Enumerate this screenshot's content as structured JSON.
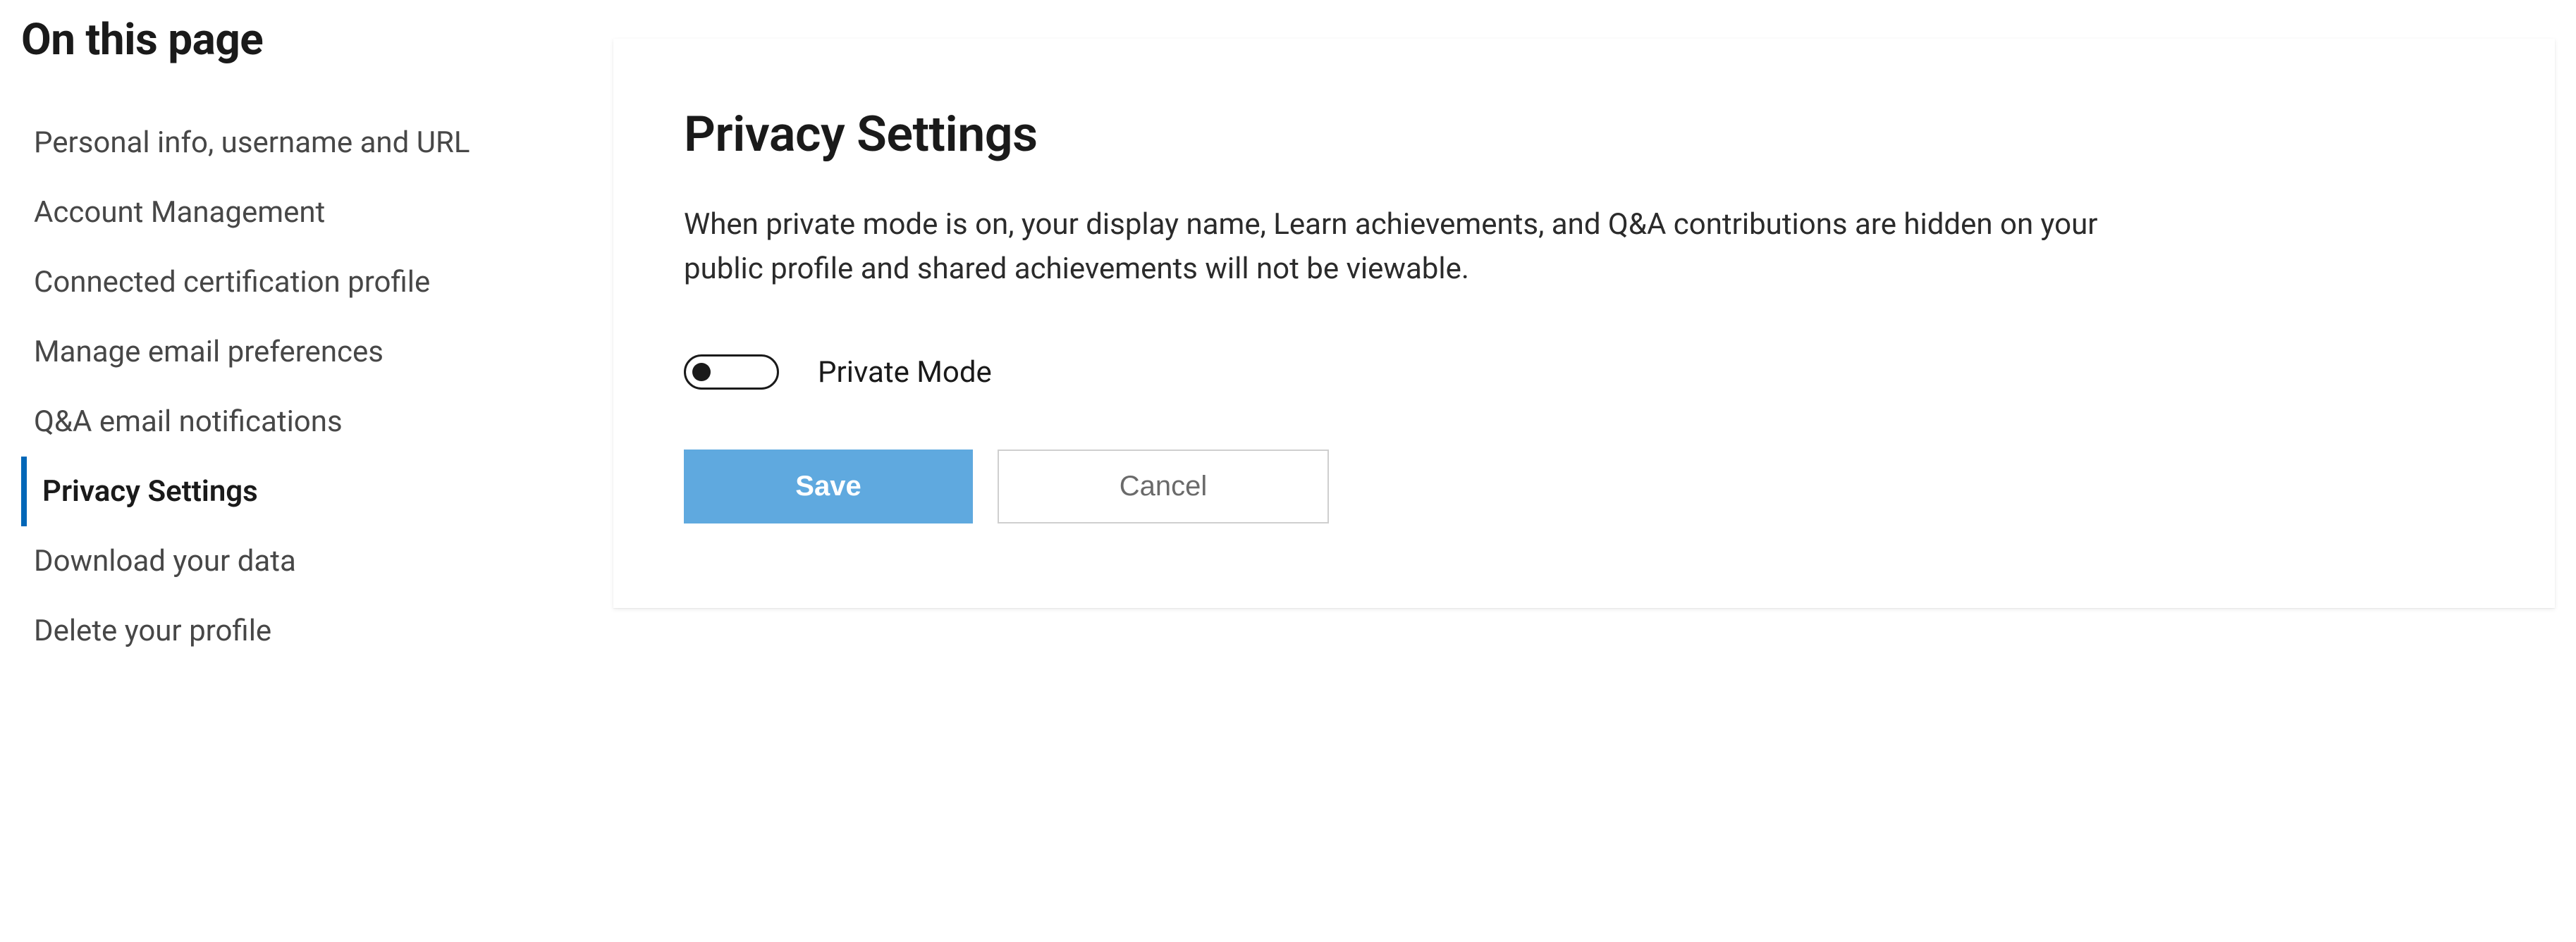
{
  "sidebar": {
    "title": "On this page",
    "items": [
      {
        "label": "Personal info, username and URL",
        "active": false
      },
      {
        "label": "Account Management",
        "active": false
      },
      {
        "label": "Connected certification profile",
        "active": false
      },
      {
        "label": "Manage email preferences",
        "active": false
      },
      {
        "label": "Q&A email notifications",
        "active": false
      },
      {
        "label": "Privacy Settings",
        "active": true
      },
      {
        "label": "Download your data",
        "active": false
      },
      {
        "label": "Delete your profile",
        "active": false
      }
    ]
  },
  "panel": {
    "title": "Privacy Settings",
    "description": "When private mode is on, your display name, Learn achievements, and Q&A contributions are hidden on your public profile and shared achievements will not be viewable.",
    "toggle": {
      "label": "Private Mode",
      "on": false
    },
    "buttons": {
      "save": "Save",
      "cancel": "Cancel"
    }
  }
}
